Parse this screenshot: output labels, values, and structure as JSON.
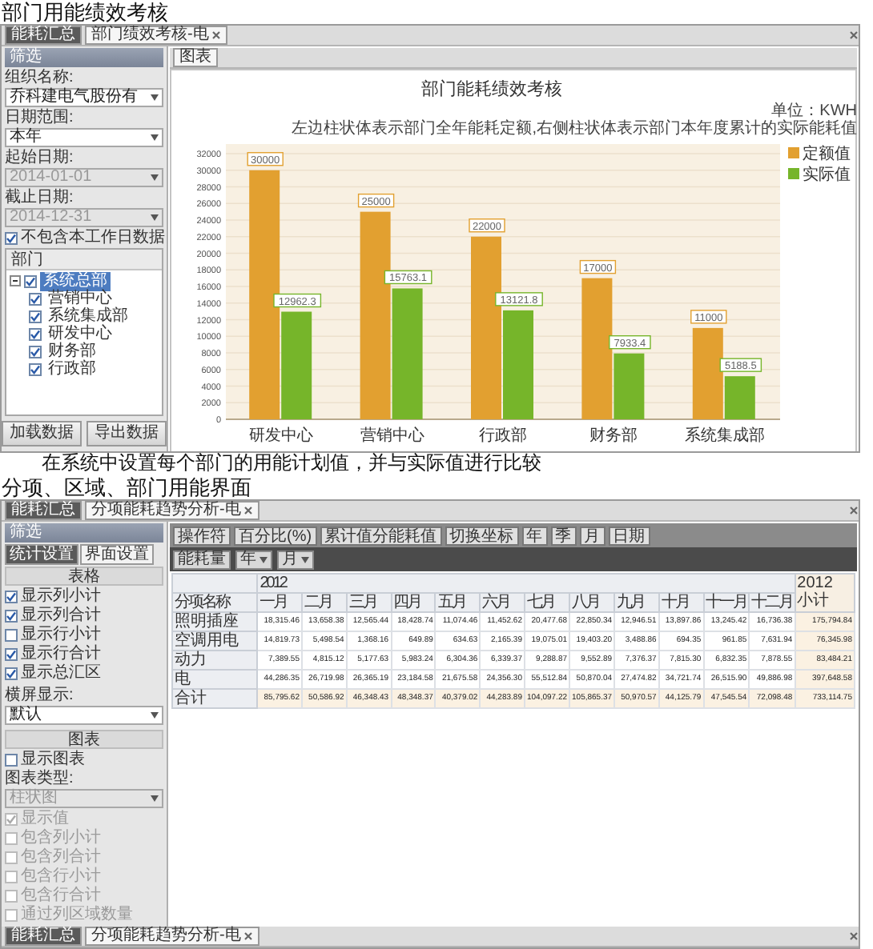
{
  "heading": "部门用能绩效考核",
  "app1": {
    "tabs": [
      {
        "label": "能耗汇总",
        "selected": false,
        "closable": false
      },
      {
        "label": "部门绩效考核-电",
        "selected": true,
        "closable": true
      }
    ],
    "filter": {
      "title": "筛选",
      "fields": [
        {
          "label": "组织名称:",
          "value": "乔科建电气股份有",
          "disabled": false
        },
        {
          "label": "日期范围:",
          "value": "本年",
          "disabled": false
        },
        {
          "label": "起始日期:",
          "value": "2014-01-01",
          "disabled": true
        },
        {
          "label": "截止日期:",
          "value": "2014-12-31",
          "disabled": true
        }
      ],
      "option": {
        "label": "不包含本工作日数据",
        "checked": true
      },
      "tree": {
        "header": "部门",
        "items": [
          {
            "label": "系统总部",
            "checked": true,
            "selected": true,
            "expanded": true,
            "children": [
              {
                "label": "营销中心",
                "checked": true,
                "selected": false
              },
              {
                "label": "系统集成部",
                "checked": true,
                "selected": false
              },
              {
                "label": "研发中心",
                "checked": true,
                "selected": false
              },
              {
                "label": "财务部",
                "checked": true,
                "selected": false
              },
              {
                "label": "行政部",
                "checked": true,
                "selected": false
              }
            ]
          }
        ]
      },
      "buttons": [
        "加载数据",
        "导出数据"
      ]
    },
    "view_tabs": [
      {
        "label": "图表",
        "selected": true
      }
    ],
    "unit": "单位：KWH",
    "note": "左边柱状体表示部门全年能耗定额,右侧柱状体表示部门本年度累计的实际能耗值",
    "chart_data": {
      "type": "bar",
      "title": "部门能耗绩效考核",
      "categories": [
        "研发中心",
        "营销中心",
        "行政部",
        "财务部",
        "系统集成部"
      ],
      "series": [
        {
          "name": "定额值",
          "color": "#e2a030",
          "values": [
            30000,
            25000,
            22000,
            17000,
            11000
          ]
        },
        {
          "name": "实际值",
          "color": "#76b52a",
          "values": [
            12962.3,
            15763.1,
            13121.8,
            7933.4,
            5188.5
          ]
        }
      ],
      "grid": true,
      "legend": "right",
      "ylim": [
        0,
        32000
      ],
      "yticks": [
        0,
        2000,
        4000,
        6000,
        8000,
        10000,
        12000,
        14000,
        16000,
        18000,
        20000,
        22000,
        24000,
        26000,
        28000,
        30000,
        32000
      ],
      "data_labels": true
    }
  },
  "paragraph": "在系统中设置每个部门的用能计划值，并与实际值进行比较",
  "heading2": "分项、区域、部门用能界面",
  "app2": {
    "tabs": [
      {
        "label": "能耗汇总",
        "selected": false,
        "closable": false
      },
      {
        "label": "分项能耗趋势分析-电",
        "selected": true,
        "closable": true
      }
    ],
    "filter": {
      "title": "筛选",
      "tabs": [
        {
          "label": "统计设置",
          "selected": true
        },
        {
          "label": "界面设置",
          "selected": false
        }
      ],
      "table_section": {
        "title": "表格",
        "options": [
          {
            "label": "显示列小计",
            "checked": true
          },
          {
            "label": "显示列合计",
            "checked": true
          },
          {
            "label": "显示行小计",
            "checked": false
          },
          {
            "label": "显示行合计",
            "checked": true
          },
          {
            "label": "显示总汇区",
            "checked": true
          }
        ],
        "select_label": "横屏显示:",
        "select_value": "默认"
      },
      "chart_section": {
        "title": "图表",
        "show_chart": {
          "label": "显示图表",
          "checked": false
        },
        "type_label": "图表类型:",
        "type_value": "柱状图",
        "type_disabled": true,
        "options": [
          {
            "label": "显示值",
            "checked": true,
            "disabled": true
          },
          {
            "label": "包含列小计",
            "checked": false,
            "disabled": true
          },
          {
            "label": "包含列合计",
            "checked": false,
            "disabled": true
          },
          {
            "label": "包含行小计",
            "checked": false,
            "disabled": true
          },
          {
            "label": "包含行合计",
            "checked": false,
            "disabled": true
          },
          {
            "label": "通过列区域数量",
            "checked": false,
            "disabled": true
          }
        ]
      }
    },
    "toolbar": [
      "操作符",
      "百分比(%)",
      "累计值分能耗值",
      "切换坐标",
      "年",
      "季",
      "月",
      "日期"
    ],
    "measure": "能耗量",
    "filters": [
      "年",
      "月"
    ],
    "table": {
      "year": "2012",
      "row_header": "分项名称",
      "columns": [
        "一月",
        "二月",
        "三月",
        "四月",
        "五月",
        "六月",
        "七月",
        "八月",
        "九月",
        "十月",
        "十一月",
        "十二月"
      ],
      "total_header": "2012 小计",
      "rows": [
        {
          "kind": "data",
          "label": "照明插座",
          "values": [
            "18,315.46",
            "13,658.38",
            "12,565.44",
            "18,428.74",
            "11,074.46",
            "11,452.62",
            "20,477.68",
            "22,850.34",
            "12,946.51",
            "13,897.86",
            "13,245.42",
            "16,736.38"
          ],
          "total": "175,794.84"
        },
        {
          "kind": "data",
          "label": "空调用电",
          "values": [
            "14,819.73",
            "5,498.54",
            "1,368.16",
            "649.89",
            "634.63",
            "2,165.39",
            "19,075.01",
            "19,403.20",
            "3,488.86",
            "694.35",
            "961.85",
            "7,631.94"
          ],
          "total": "76,345.98"
        },
        {
          "kind": "data",
          "label": "动力",
          "values": [
            "7,389.55",
            "4,815.12",
            "5,177.63",
            "5,983.24",
            "6,304.36",
            "6,339.37",
            "9,288.87",
            "9,552.89",
            "7,376.37",
            "7,815.30",
            "6,832.35",
            "7,878.55"
          ],
          "total": "83,484.21"
        },
        {
          "kind": "data",
          "label": "电",
          "values": [
            "44,286.35",
            "26,719.98",
            "26,365.19",
            "23,184.58",
            "21,675.58",
            "24,356.30",
            "55,512.84",
            "50,870.04",
            "27,474.82",
            "34,721.74",
            "26,515.90",
            "49,886.98"
          ],
          "total": "397,648.58"
        },
        {
          "kind": "total",
          "label": "合计",
          "values": [
            "85,795.62",
            "50,586.92",
            "46,348.43",
            "48,348.37",
            "40,379.02",
            "44,283.89",
            "104,097.22",
            "105,865.37",
            "50,970.57",
            "44,125.79",
            "47,545.54",
            "72,098.48"
          ],
          "total": "733,114.75"
        }
      ]
    },
    "footer_tabs": [
      {
        "label": "能耗汇总",
        "selected": false,
        "closable": false
      },
      {
        "label": "分项能耗趋势分析-电",
        "selected": true,
        "closable": true
      }
    ]
  }
}
